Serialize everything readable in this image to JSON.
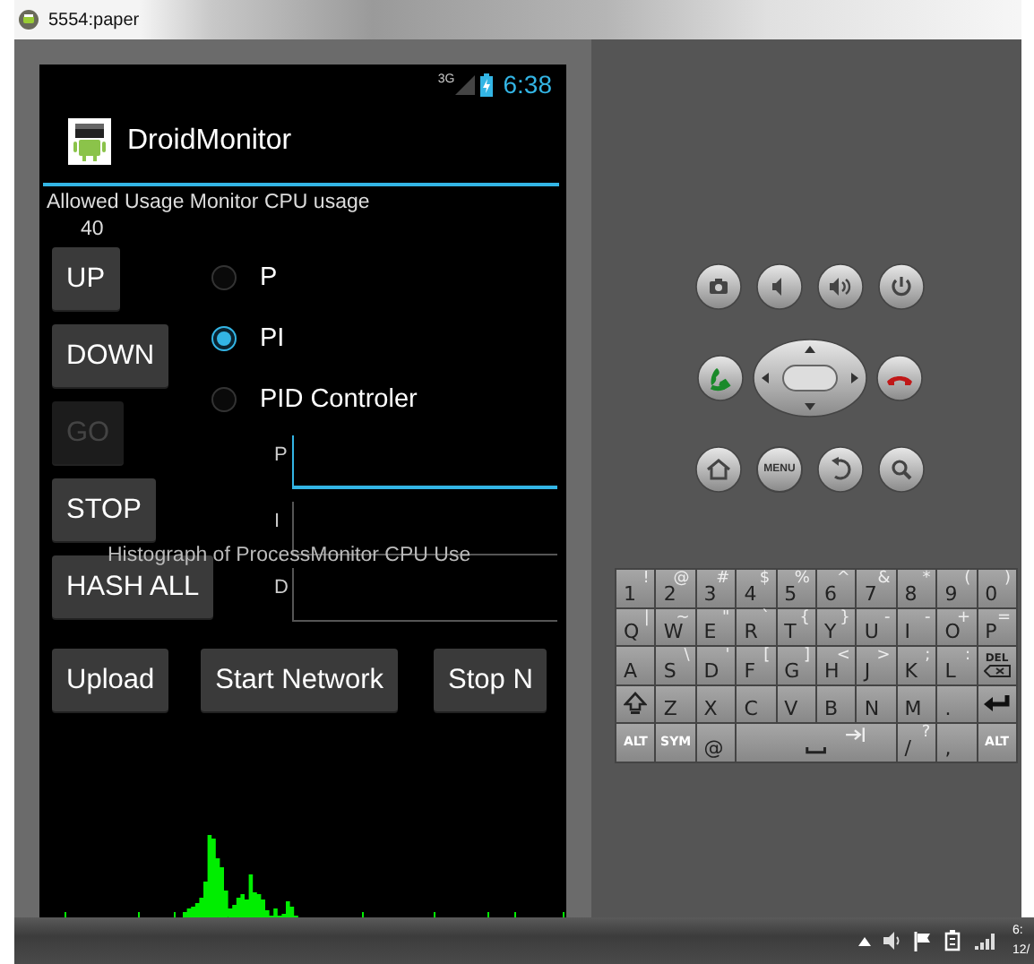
{
  "window": {
    "title": "5554:paper"
  },
  "phone": {
    "status_bar": {
      "network": "3G",
      "time": "6:38"
    },
    "app": {
      "title": "DroidMonitor",
      "usage_label": "Allowed Usage Monitor CPU usage",
      "usage_value": "40",
      "buttons": [
        {
          "label": "UP",
          "disabled": false
        },
        {
          "label": "DOWN",
          "disabled": false
        },
        {
          "label": "GO",
          "disabled": true
        },
        {
          "label": "STOP",
          "disabled": false
        },
        {
          "label": "HASH ALL",
          "disabled": false
        }
      ],
      "modes": [
        {
          "label": "P",
          "selected": false
        },
        {
          "label": "PI",
          "selected": true
        },
        {
          "label": "PID Controler",
          "selected": false
        }
      ],
      "gains": [
        {
          "label": "P",
          "focused": true
        },
        {
          "label": "I",
          "focused": false
        },
        {
          "label": "D",
          "focused": false
        }
      ],
      "bottom_buttons": [
        "Upload",
        "Start Network",
        "Stop N"
      ],
      "histogram": {
        "title": "Histograph of ProcessMonitor CPU Use"
      }
    }
  },
  "hardware_keys": {
    "menu_label": "MENU"
  },
  "keyboard": {
    "rows": [
      {
        "keys": [
          {
            "kind": "char",
            "label": "1",
            "alt": "!"
          },
          {
            "kind": "char",
            "label": "2",
            "alt": "@"
          },
          {
            "kind": "char",
            "label": "3",
            "alt": "#"
          },
          {
            "kind": "char",
            "label": "4",
            "alt": "$"
          },
          {
            "kind": "char",
            "label": "5",
            "alt": "%"
          },
          {
            "kind": "char",
            "label": "6",
            "alt": "^"
          },
          {
            "kind": "char",
            "label": "7",
            "alt": "&"
          },
          {
            "kind": "char",
            "label": "8",
            "alt": "*"
          },
          {
            "kind": "char",
            "label": "9",
            "alt": "("
          },
          {
            "kind": "char",
            "label": "0",
            "alt": ")"
          }
        ]
      },
      {
        "keys": [
          {
            "kind": "char",
            "label": "Q",
            "alt": "|"
          },
          {
            "kind": "char",
            "label": "W",
            "alt": "~"
          },
          {
            "kind": "char",
            "label": "E",
            "alt": "\""
          },
          {
            "kind": "char",
            "label": "R",
            "alt": "`"
          },
          {
            "kind": "char",
            "label": "T",
            "alt": "{"
          },
          {
            "kind": "char",
            "label": "Y",
            "alt": "}"
          },
          {
            "kind": "char",
            "label": "U",
            "alt": "-"
          },
          {
            "kind": "char",
            "label": "I",
            "alt": "-"
          },
          {
            "kind": "char",
            "label": "O",
            "alt": "+"
          },
          {
            "kind": "char",
            "label": "P",
            "alt": "="
          }
        ]
      },
      {
        "keys": [
          {
            "kind": "char",
            "label": "A"
          },
          {
            "kind": "char",
            "label": "S",
            "alt": "\\"
          },
          {
            "kind": "char",
            "label": "D",
            "alt": "'"
          },
          {
            "kind": "char",
            "label": "F",
            "alt": "["
          },
          {
            "kind": "char",
            "label": "G",
            "alt": "]"
          },
          {
            "kind": "char",
            "label": "H",
            "alt": "<"
          },
          {
            "kind": "char",
            "label": "J",
            "alt": ">"
          },
          {
            "kind": "char",
            "label": "K",
            "alt": ";"
          },
          {
            "kind": "char",
            "label": "L",
            "alt": ":"
          },
          {
            "kind": "del",
            "label": "DEL"
          }
        ]
      },
      {
        "keys": [
          {
            "kind": "shift"
          },
          {
            "kind": "char",
            "label": "Z"
          },
          {
            "kind": "char",
            "label": "X"
          },
          {
            "kind": "char",
            "label": "C"
          },
          {
            "kind": "char",
            "label": "V"
          },
          {
            "kind": "char",
            "label": "B"
          },
          {
            "kind": "char",
            "label": "N"
          },
          {
            "kind": "char",
            "label": "M"
          },
          {
            "kind": "char",
            "label": "."
          },
          {
            "kind": "enter"
          }
        ]
      },
      {
        "keys": [
          {
            "kind": "mod",
            "label": "ALT"
          },
          {
            "kind": "mod",
            "label": "SYM"
          },
          {
            "kind": "char",
            "label": "@"
          },
          {
            "kind": "space"
          },
          {
            "kind": "char",
            "label": "/",
            "alt": "?"
          },
          {
            "kind": "char",
            "label": ","
          },
          {
            "kind": "mod",
            "label": "ALT"
          }
        ]
      }
    ]
  },
  "taskbar": {
    "clock": [
      "6:",
      "12/"
    ]
  }
}
